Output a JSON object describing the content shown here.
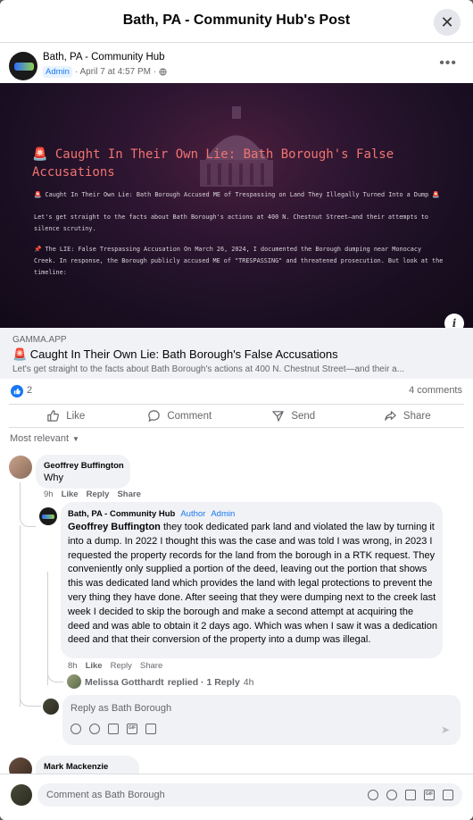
{
  "dialog": {
    "title": "Bath, PA - Community Hub's Post",
    "close_icon": "close-icon"
  },
  "post": {
    "page_name": "Bath, PA - Community Hub",
    "role_badge": "Admin",
    "date": "· April 7 at 4:57 PM ·",
    "privacy_icon": "globe-icon",
    "more_icon": "more-icon"
  },
  "hero": {
    "title": "🚨 Caught In Their Own Lie: Bath Borough's False Accusations",
    "p1": "🚨 Caught In Their Own Lie: Bath Borough Accused ME of Trespassing on Land They Illegally Turned Into a Dump 🚨",
    "p2": "Let's get straight to the facts about Bath Borough's actions at 400 N. Chestnut Street—and their attempts to silence scrutiny.",
    "p3": "📌 The LIE: False Trespassing Accusation On March 26, 2024, I documented the Borough dumping near Monocacy Creek. In response, the Borough publicly accused ME of \"TRESPASSING\" and threatened prosecution. But look at the timeline:"
  },
  "link": {
    "domain": "GAMMA.APP",
    "title": "🚨 Caught In Their Own Lie: Bath Borough's False Accusations",
    "description": "Let's get straight to the facts about Bath Borough's actions at 400 N. Chestnut Street—and their a..."
  },
  "stats": {
    "likes": "2",
    "comments": "4 comments"
  },
  "actions": {
    "like": "Like",
    "comment": "Comment",
    "send": "Send",
    "share": "Share"
  },
  "sort_label": "Most relevant",
  "comments": [
    {
      "name": "Geoffrey Buffington",
      "text": "Why",
      "time": "9h",
      "like": "Like",
      "reply": "Reply",
      "share": "Share"
    }
  ],
  "reply": {
    "name": "Bath, PA - Community Hub",
    "badge_author": "Author",
    "badge_admin": "Admin",
    "mention": "Geoffrey Buffington",
    "text": " they took dedicated park land and violated the law by turning it into a dump. In 2022 I thought this was the case and was told I was wrong, in 2023 I requested the property records for the land from the borough in a RTK request. They conveniently only supplied a portion of the deed, leaving out the portion that shows this was dedicated land which provides the land with legal protections to prevent the very thing they have done. After seeing that they were dumping next to the creek last week I decided to skip the borough and make a second attempt at acquiring the deed and was able to obtain it 2 days ago. Which was when I saw it was a dedication deed and that their conversion of the property into a dump was illegal.",
    "time": "8h",
    "like": "Like",
    "reply": "Reply",
    "share": "Share"
  },
  "nested_reply": {
    "name": "Melissa Gotthardt",
    "text": "replied · 1 Reply",
    "time": "4h"
  },
  "reply_box": {
    "placeholder": "Reply as Bath Borough"
  },
  "comment_2": {
    "name": "Mark Mackenzie"
  },
  "footer": {
    "placeholder": "Comment as Bath Borough"
  }
}
